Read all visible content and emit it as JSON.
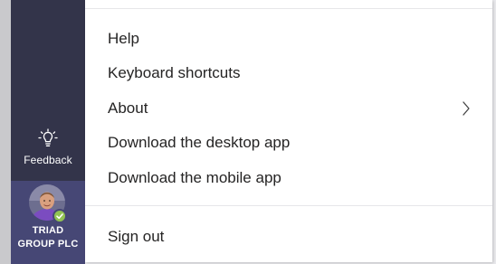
{
  "sidebar": {
    "feedback_label": "Feedback",
    "account": {
      "org_line1": "TRIAD",
      "org_line2": "GROUP PLC",
      "presence": "available"
    }
  },
  "menu": {
    "items": [
      {
        "label": "Help"
      },
      {
        "label": "Keyboard shortcuts"
      },
      {
        "label": "About",
        "has_submenu": true
      },
      {
        "label": "Download the desktop app"
      },
      {
        "label": "Download the mobile app"
      }
    ],
    "sign_out_label": "Sign out"
  },
  "colors": {
    "rail": "#33344a",
    "account_bg": "#464775",
    "presence_available": "#92c353",
    "menu_text": "#252424"
  }
}
